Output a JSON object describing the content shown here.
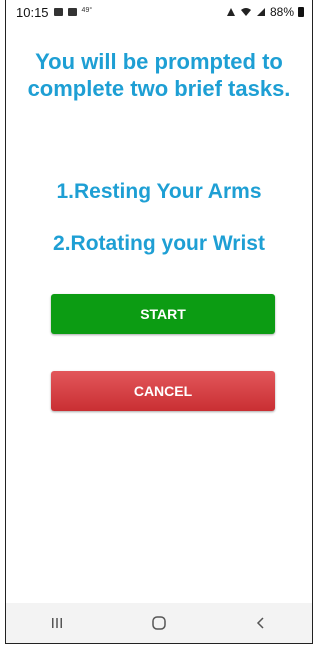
{
  "status_bar": {
    "time": "10:15",
    "temperature": "49°",
    "battery": "88%"
  },
  "intro": {
    "text": "You will be prompted to complete two brief tasks."
  },
  "tasks": [
    {
      "label": "1.Resting Your Arms"
    },
    {
      "label": "2.Rotating your Wrist"
    }
  ],
  "buttons": {
    "start_label": "START",
    "cancel_label": "CANCEL"
  },
  "colors": {
    "heading": "#1e9fd4",
    "start": "#0c9c13",
    "cancel": "#d13c40"
  },
  "nav_bar": {
    "recents_icon": "recents-icon",
    "home_icon": "home-icon",
    "back_icon": "back-icon"
  }
}
